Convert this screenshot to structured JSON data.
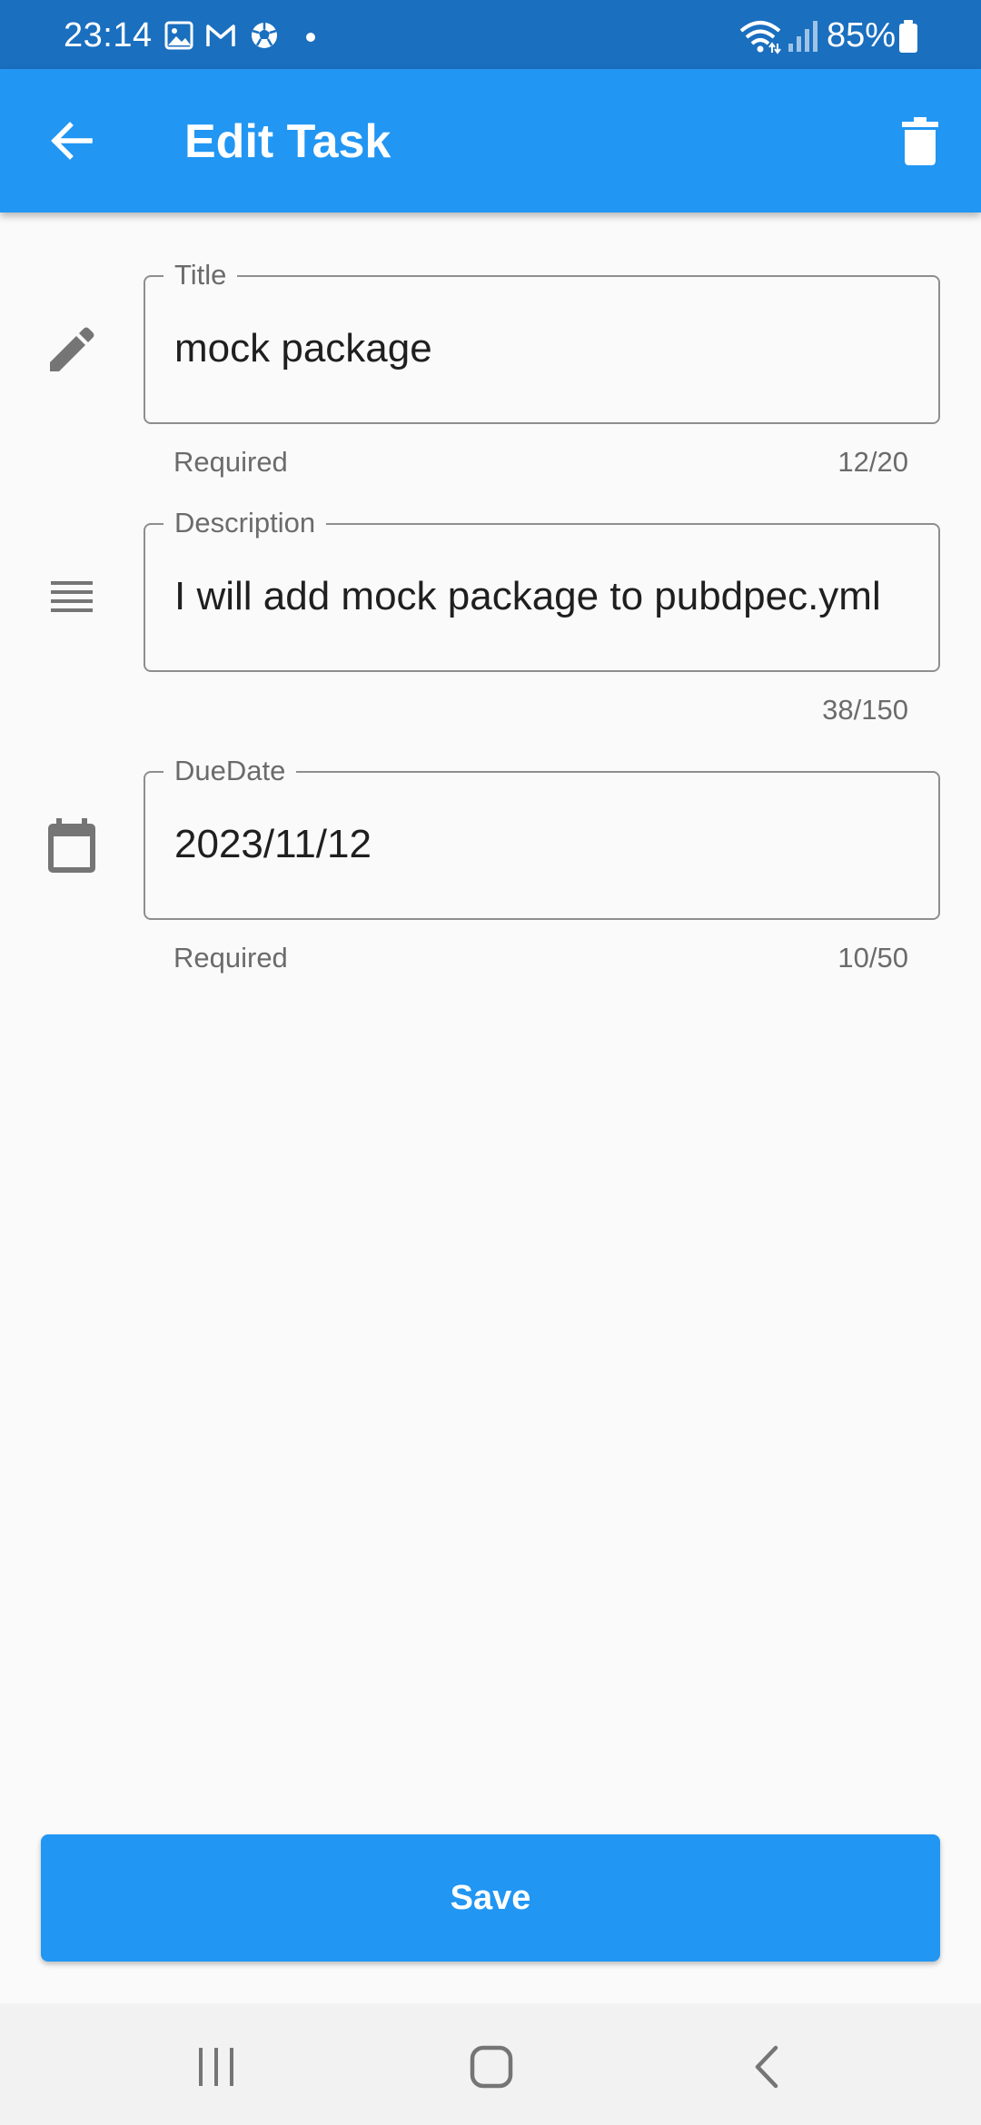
{
  "status_bar": {
    "time": "23:14",
    "battery": "85%",
    "notification_icons": [
      "gallery-icon",
      "gmail-icon",
      "soccer-ball-icon",
      "dot-icon"
    ],
    "system_icons": [
      "wifi-icon",
      "signal-icon",
      "battery-icon"
    ]
  },
  "app_bar": {
    "title": "Edit Task",
    "back_icon": "arrow-back-icon",
    "delete_icon": "trash-icon"
  },
  "form": {
    "title_field": {
      "label": "Title",
      "value": "mock package",
      "helper": "Required",
      "counter": "12/20",
      "icon": "pencil-icon"
    },
    "description_field": {
      "label": "Description",
      "value": "I will add mock package to pubdpec.yml",
      "helper": "",
      "counter": "38/150",
      "icon": "notes-lines-icon"
    },
    "duedate_field": {
      "label": "DueDate",
      "value": "2023/11/12",
      "helper": "Required",
      "counter": "10/50",
      "icon": "calendar-icon"
    }
  },
  "save_button": {
    "label": "Save"
  },
  "colors": {
    "primary": "#2196f3",
    "status_bar": "#1a6fbf",
    "background": "#fafafa",
    "field_border": "#8e8e8e",
    "secondary_text": "#6b6b6b"
  },
  "nav_bar": {
    "recent_icon": "recent-apps-icon",
    "home_icon": "home-icon",
    "back_icon": "nav-back-icon"
  }
}
